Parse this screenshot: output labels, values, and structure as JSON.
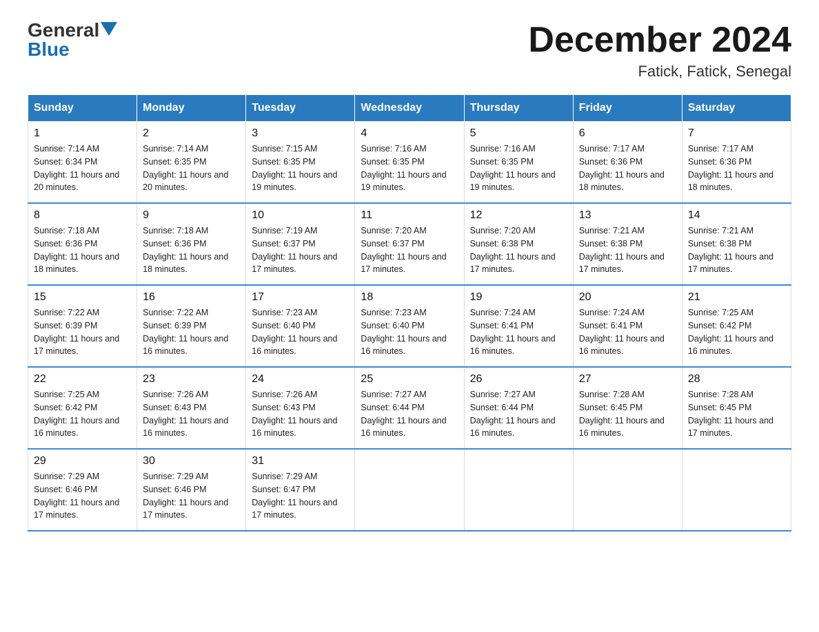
{
  "header": {
    "logo_general": "General",
    "logo_blue": "Blue",
    "month_title": "December 2024",
    "location": "Fatick, Fatick, Senegal"
  },
  "columns": [
    "Sunday",
    "Monday",
    "Tuesday",
    "Wednesday",
    "Thursday",
    "Friday",
    "Saturday"
  ],
  "weeks": [
    [
      {
        "day": "1",
        "sunrise": "7:14 AM",
        "sunset": "6:34 PM",
        "daylight": "11 hours and 20 minutes."
      },
      {
        "day": "2",
        "sunrise": "7:14 AM",
        "sunset": "6:35 PM",
        "daylight": "11 hours and 20 minutes."
      },
      {
        "day": "3",
        "sunrise": "7:15 AM",
        "sunset": "6:35 PM",
        "daylight": "11 hours and 19 minutes."
      },
      {
        "day": "4",
        "sunrise": "7:16 AM",
        "sunset": "6:35 PM",
        "daylight": "11 hours and 19 minutes."
      },
      {
        "day": "5",
        "sunrise": "7:16 AM",
        "sunset": "6:35 PM",
        "daylight": "11 hours and 19 minutes."
      },
      {
        "day": "6",
        "sunrise": "7:17 AM",
        "sunset": "6:36 PM",
        "daylight": "11 hours and 18 minutes."
      },
      {
        "day": "7",
        "sunrise": "7:17 AM",
        "sunset": "6:36 PM",
        "daylight": "11 hours and 18 minutes."
      }
    ],
    [
      {
        "day": "8",
        "sunrise": "7:18 AM",
        "sunset": "6:36 PM",
        "daylight": "11 hours and 18 minutes."
      },
      {
        "day": "9",
        "sunrise": "7:18 AM",
        "sunset": "6:36 PM",
        "daylight": "11 hours and 18 minutes."
      },
      {
        "day": "10",
        "sunrise": "7:19 AM",
        "sunset": "6:37 PM",
        "daylight": "11 hours and 17 minutes."
      },
      {
        "day": "11",
        "sunrise": "7:20 AM",
        "sunset": "6:37 PM",
        "daylight": "11 hours and 17 minutes."
      },
      {
        "day": "12",
        "sunrise": "7:20 AM",
        "sunset": "6:38 PM",
        "daylight": "11 hours and 17 minutes."
      },
      {
        "day": "13",
        "sunrise": "7:21 AM",
        "sunset": "6:38 PM",
        "daylight": "11 hours and 17 minutes."
      },
      {
        "day": "14",
        "sunrise": "7:21 AM",
        "sunset": "6:38 PM",
        "daylight": "11 hours and 17 minutes."
      }
    ],
    [
      {
        "day": "15",
        "sunrise": "7:22 AM",
        "sunset": "6:39 PM",
        "daylight": "11 hours and 17 minutes."
      },
      {
        "day": "16",
        "sunrise": "7:22 AM",
        "sunset": "6:39 PM",
        "daylight": "11 hours and 16 minutes."
      },
      {
        "day": "17",
        "sunrise": "7:23 AM",
        "sunset": "6:40 PM",
        "daylight": "11 hours and 16 minutes."
      },
      {
        "day": "18",
        "sunrise": "7:23 AM",
        "sunset": "6:40 PM",
        "daylight": "11 hours and 16 minutes."
      },
      {
        "day": "19",
        "sunrise": "7:24 AM",
        "sunset": "6:41 PM",
        "daylight": "11 hours and 16 minutes."
      },
      {
        "day": "20",
        "sunrise": "7:24 AM",
        "sunset": "6:41 PM",
        "daylight": "11 hours and 16 minutes."
      },
      {
        "day": "21",
        "sunrise": "7:25 AM",
        "sunset": "6:42 PM",
        "daylight": "11 hours and 16 minutes."
      }
    ],
    [
      {
        "day": "22",
        "sunrise": "7:25 AM",
        "sunset": "6:42 PM",
        "daylight": "11 hours and 16 minutes."
      },
      {
        "day": "23",
        "sunrise": "7:26 AM",
        "sunset": "6:43 PM",
        "daylight": "11 hours and 16 minutes."
      },
      {
        "day": "24",
        "sunrise": "7:26 AM",
        "sunset": "6:43 PM",
        "daylight": "11 hours and 16 minutes."
      },
      {
        "day": "25",
        "sunrise": "7:27 AM",
        "sunset": "6:44 PM",
        "daylight": "11 hours and 16 minutes."
      },
      {
        "day": "26",
        "sunrise": "7:27 AM",
        "sunset": "6:44 PM",
        "daylight": "11 hours and 16 minutes."
      },
      {
        "day": "27",
        "sunrise": "7:28 AM",
        "sunset": "6:45 PM",
        "daylight": "11 hours and 16 minutes."
      },
      {
        "day": "28",
        "sunrise": "7:28 AM",
        "sunset": "6:45 PM",
        "daylight": "11 hours and 17 minutes."
      }
    ],
    [
      {
        "day": "29",
        "sunrise": "7:29 AM",
        "sunset": "6:46 PM",
        "daylight": "11 hours and 17 minutes."
      },
      {
        "day": "30",
        "sunrise": "7:29 AM",
        "sunset": "6:46 PM",
        "daylight": "11 hours and 17 minutes."
      },
      {
        "day": "31",
        "sunrise": "7:29 AM",
        "sunset": "6:47 PM",
        "daylight": "11 hours and 17 minutes."
      },
      null,
      null,
      null,
      null
    ]
  ]
}
